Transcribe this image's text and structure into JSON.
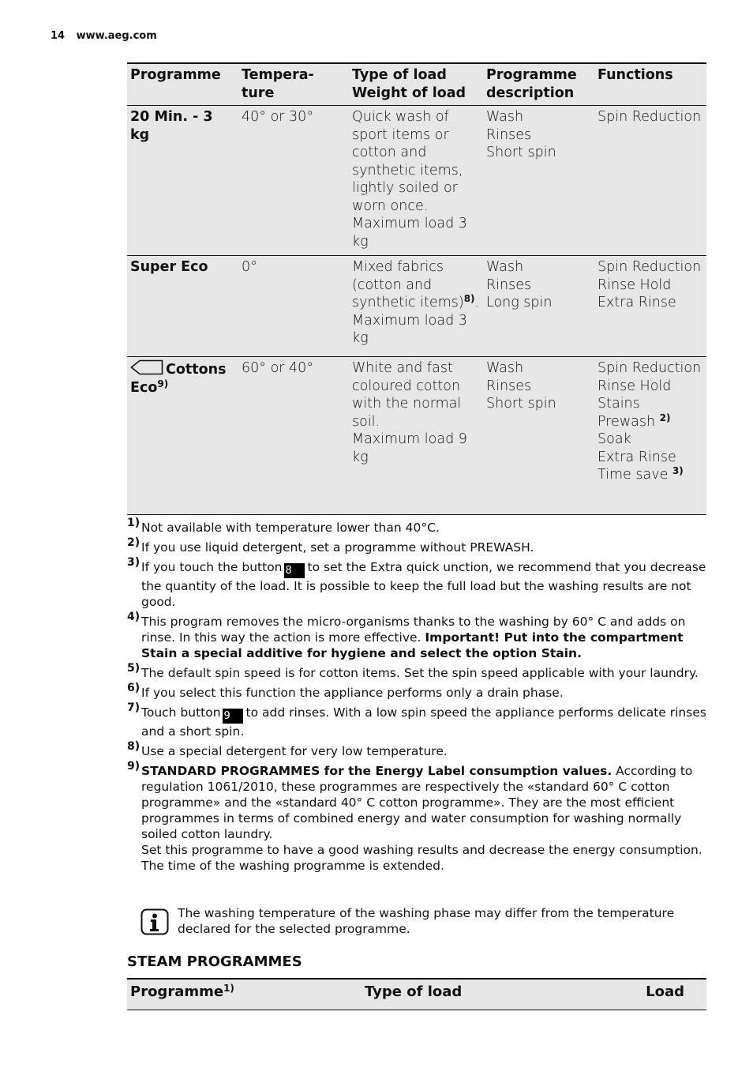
{
  "header": {
    "page_number": "14",
    "site": "www.aeg.com"
  },
  "programmes_table": {
    "columns": [
      "Programme",
      "Tempera-\nture",
      "Type of load\nWeight of load",
      "Programme\ndescription",
      "Functions"
    ],
    "rows": [
      {
        "programme": "20 Min. - 3 kg",
        "programme_footnote": "",
        "icon": "",
        "temperature": "40° or 30°",
        "load_text": "Quick wash of sport items or cotton and synthetic items, lightly soiled or worn once.",
        "load_footnote": "",
        "load_max": "Maximum load 3 kg",
        "description": [
          "Wash",
          "Rinses",
          "Short spin"
        ],
        "functions": [
          {
            "label": "Spin Reduction",
            "footnote": ""
          }
        ]
      },
      {
        "programme": "Super Eco",
        "programme_footnote": "",
        "icon": "",
        "temperature": "0°",
        "load_text": "Mixed fabrics (cotton and synthetic items)",
        "load_footnote": "8)",
        "load_max": "Maximum load 3 kg",
        "description": [
          "Wash",
          "Rinses",
          "Long spin"
        ],
        "functions": [
          {
            "label": "Spin Reduction",
            "footnote": ""
          },
          {
            "label": "Rinse Hold",
            "footnote": ""
          },
          {
            "label": "Extra Rinse",
            "footnote": ""
          }
        ]
      },
      {
        "programme": "Cottons Eco",
        "programme_footnote": "9)",
        "icon": "eco-tag-icon",
        "temperature": "60° or 40°",
        "load_text": "White and fast coloured cotton with the normal soil.",
        "load_footnote": "",
        "load_max": "Maximum load 9 kg",
        "description": [
          "Wash",
          "Rinses",
          "Short spin"
        ],
        "functions": [
          {
            "label": "Spin Reduction",
            "footnote": ""
          },
          {
            "label": "Rinse Hold",
            "footnote": ""
          },
          {
            "label": "Stains",
            "footnote": ""
          },
          {
            "label": "Prewash",
            "footnote": "2)"
          },
          {
            "label": "Soak",
            "footnote": ""
          },
          {
            "label": "Extra Rinse",
            "footnote": ""
          },
          {
            "label": "Time save",
            "footnote": "3)"
          }
        ]
      }
    ]
  },
  "footnotes": [
    {
      "mark": "1)",
      "text": "Not available with temperature lower than 40°C."
    },
    {
      "mark": "2)",
      "text": "If you use liquid detergent, set a programme without PREWASH."
    },
    {
      "mark": "3)",
      "text_before": "If you touch the button",
      "button": "8",
      "text_after": "to set the Extra quick unction, we recommend that you decrease the quantity of the load. It is possible to keep the full load but the washing results are not good."
    },
    {
      "mark": "4)",
      "text": "This program removes the micro-organisms thanks to the washing by 60° C and adds on rinse. In this way the action is more effective.",
      "bold": "Important! Put into the compartment Stain a special additive for hygiene and select the option Stain."
    },
    {
      "mark": "5)",
      "text": "The default spin speed is for cotton items. Set the spin speed applicable with your laundry."
    },
    {
      "mark": "6)",
      "text": "If you select this function the appliance performs only a drain phase."
    },
    {
      "mark": "7)",
      "text_before": "Touch button",
      "button": "9",
      "text_after": "to add rinses. With a low spin speed the appliance performs delicate rinses and a short spin."
    },
    {
      "mark": "8)",
      "text": "Use a special detergent for very low temperature."
    },
    {
      "mark": "9)",
      "bold": "STANDARD PROGRAMMES for the Energy Label consumption values.",
      "text": "According to regulation 1061/2010, these programmes are respectively the «standard 60° C cotton programme» and the «standard 40° C cotton programme». They are the most efficient programmes in terms of combined energy and water consumption for washing normally soiled cotton laundry.",
      "text2": "Set this programme to have a good washing results and decrease the energy consumption. The time of the washing programme is extended."
    }
  ],
  "info_note": {
    "icon": "info-icon",
    "text": "The washing temperature of the washing phase may differ from the temperature declared for the selected programme."
  },
  "steam_section": {
    "title": "STEAM PROGRAMMES",
    "columns": [
      {
        "label": "Programme",
        "footnote": "1)"
      },
      {
        "label": "Type of load",
        "footnote": ""
      },
      {
        "label": "Load",
        "footnote": ""
      }
    ]
  }
}
